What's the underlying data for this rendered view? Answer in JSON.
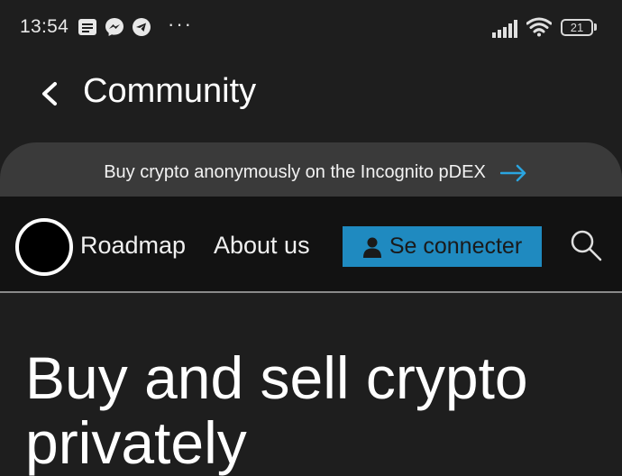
{
  "status_bar": {
    "time": "13:54",
    "more": "···",
    "battery_level": "21",
    "icons": [
      "notes-icon",
      "messenger-icon",
      "telegram-icon",
      "signal-icon",
      "wifi-icon",
      "battery-icon"
    ]
  },
  "header": {
    "back_icon": "chevron-left-icon",
    "title": "Community"
  },
  "banner": {
    "text": "Buy crypto anonymously on the Incognito pDEX",
    "icon": "arrow-right-icon",
    "arrow_color": "#2aa5e0"
  },
  "site_nav": {
    "links": [
      "Roadmap",
      "About us"
    ],
    "login_label": "Se connecter",
    "login_icon": "user-icon",
    "search_icon": "search-icon",
    "login_color": "#1f8ac0"
  },
  "hero": {
    "title": "Buy and sell crypto privately"
  }
}
